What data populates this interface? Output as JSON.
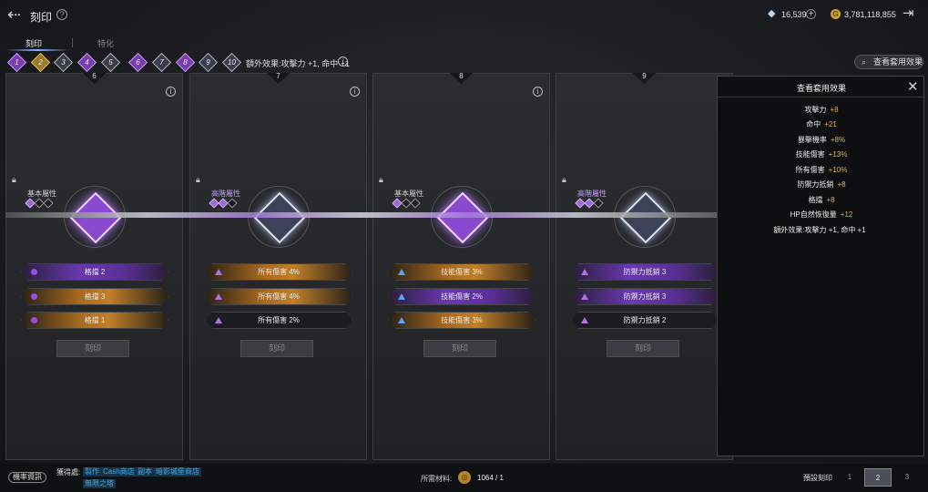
{
  "header": {
    "title": "刻印",
    "gems": "16,539",
    "gold": "3,781,118,855",
    "gold_icon": "G"
  },
  "tabs": [
    "刻印",
    "特化"
  ],
  "slots": [
    "1",
    "2",
    "3",
    "4",
    "5",
    "6",
    "7",
    "8",
    "9",
    "10"
  ],
  "extra_effect": "額外效果:攻擊力 +1, 命中 +1",
  "view_button": "查看套用效果",
  "panels": [
    {
      "num": "6",
      "attr": "基本屬性",
      "stats": [
        "格擋 2",
        "格擋 3",
        "格擋 1"
      ]
    },
    {
      "num": "7",
      "attr": "高階屬性",
      "stats": [
        "所有傷害 4%",
        "所有傷害 4%",
        "所有傷害 2%"
      ]
    },
    {
      "num": "8",
      "attr": "基本屬性",
      "stats": [
        "技能傷害 3%",
        "技能傷害 2%",
        "技能傷害 3%"
      ]
    },
    {
      "num": "9",
      "attr": "高階屬性",
      "stats": [
        "防禦力抵銷 3",
        "防禦力抵銷 3",
        "防禦力抵銷 2"
      ]
    }
  ],
  "carve_label": "刻印",
  "popup": {
    "title": "查看套用效果",
    "effects": [
      {
        "name": "攻擊力",
        "value": "+8"
      },
      {
        "name": "命中",
        "value": "+21"
      },
      {
        "name": "暴擊機率",
        "value": "+8%"
      },
      {
        "name": "技能傷害",
        "value": "+13%"
      },
      {
        "name": "所有傷害",
        "value": "+10%"
      },
      {
        "name": "防禦力抵銷",
        "value": "+8"
      },
      {
        "name": "格擋",
        "value": "+8"
      },
      {
        "name": "HP自然恢復量",
        "value": "+12"
      },
      {
        "name": "額外效果:攻擊力 +1, 命中 +1",
        "value": ""
      }
    ]
  },
  "footer": {
    "prob_label": "機率資訊",
    "obtain_label": "獲得處:",
    "sources": [
      "製作",
      "Cash商店",
      "副本",
      "暗影城堡商店",
      "無限之塔"
    ],
    "required_label": "所需材料:",
    "required_value": "1064 / 1",
    "preset_label": "預設刻印",
    "presets": [
      "1",
      "2",
      "3"
    ]
  }
}
